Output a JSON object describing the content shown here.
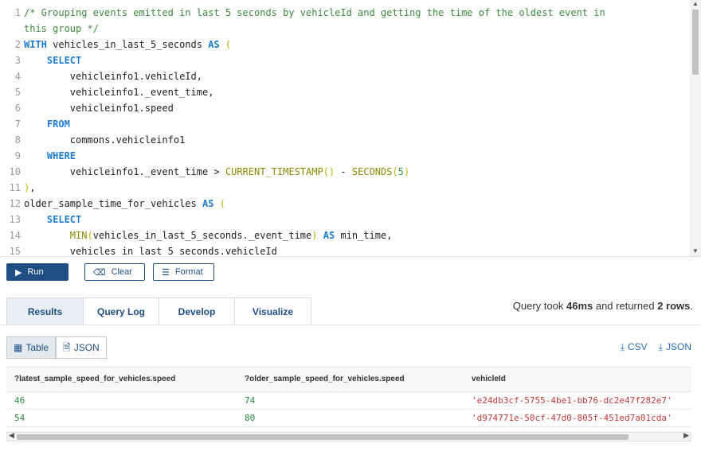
{
  "editor": {
    "lines": [
      {
        "n": "1",
        "parts": [
          {
            "c": "cm",
            "t": "/* Grouping events emitted in last 5 seconds by vehicleId and getting the time of the oldest event in"
          }
        ]
      },
      {
        "n": "",
        "parts": [
          {
            "c": "cm",
            "t": "this group */"
          }
        ]
      },
      {
        "n": "2",
        "parts": [
          {
            "c": "kw",
            "t": "WITH"
          },
          {
            "c": "txt",
            "t": " vehicles_in_last_5_seconds "
          },
          {
            "c": "kw",
            "t": "AS"
          },
          {
            "c": "pn",
            "t": " ("
          }
        ]
      },
      {
        "n": "3",
        "parts": [
          {
            "c": "txt",
            "t": "    "
          },
          {
            "c": "kw",
            "t": "SELECT"
          }
        ]
      },
      {
        "n": "4",
        "parts": [
          {
            "c": "txt",
            "t": "        vehicleinfo1.vehicleId,"
          }
        ]
      },
      {
        "n": "5",
        "parts": [
          {
            "c": "txt",
            "t": "        vehicleinfo1._event_time,"
          }
        ]
      },
      {
        "n": "6",
        "parts": [
          {
            "c": "txt",
            "t": "        vehicleinfo1.speed"
          }
        ]
      },
      {
        "n": "7",
        "parts": [
          {
            "c": "txt",
            "t": "    "
          },
          {
            "c": "kw",
            "t": "FROM"
          }
        ]
      },
      {
        "n": "8",
        "parts": [
          {
            "c": "txt",
            "t": "        commons.vehicleinfo1"
          }
        ]
      },
      {
        "n": "9",
        "parts": [
          {
            "c": "txt",
            "t": "    "
          },
          {
            "c": "kw",
            "t": "WHERE"
          }
        ]
      },
      {
        "n": "10",
        "parts": [
          {
            "c": "txt",
            "t": "        vehicleinfo1._event_time > "
          },
          {
            "c": "fn",
            "t": "CURRENT_TIMESTAMP"
          },
          {
            "c": "pn",
            "t": "()"
          },
          {
            "c": "txt",
            "t": " - "
          },
          {
            "c": "fn",
            "t": "SECONDS"
          },
          {
            "c": "pn",
            "t": "("
          },
          {
            "c": "nm",
            "t": "5"
          },
          {
            "c": "pn",
            "t": ")"
          }
        ]
      },
      {
        "n": "11",
        "parts": [
          {
            "c": "pn",
            "t": ")"
          },
          {
            "c": "txt",
            "t": ","
          }
        ]
      },
      {
        "n": "12",
        "parts": [
          {
            "c": "txt",
            "t": "older_sample_time_for_vehicles "
          },
          {
            "c": "kw",
            "t": "AS"
          },
          {
            "c": "pn",
            "t": " ("
          }
        ]
      },
      {
        "n": "13",
        "parts": [
          {
            "c": "txt",
            "t": "    "
          },
          {
            "c": "kw",
            "t": "SELECT"
          }
        ]
      },
      {
        "n": "14",
        "parts": [
          {
            "c": "txt",
            "t": "        "
          },
          {
            "c": "fn",
            "t": "MIN"
          },
          {
            "c": "pn",
            "t": "("
          },
          {
            "c": "txt",
            "t": "vehicles_in_last_5_seconds._event_time"
          },
          {
            "c": "pn",
            "t": ")"
          },
          {
            "c": "txt",
            "t": " "
          },
          {
            "c": "kw",
            "t": "AS"
          },
          {
            "c": "txt",
            "t": " min_time,"
          }
        ]
      },
      {
        "n": "15",
        "parts": [
          {
            "c": "txt",
            "t": "        vehicles_in_last_5_seconds.vehicleId"
          }
        ]
      }
    ]
  },
  "toolbar": {
    "run_label": "Run",
    "clear_label": "Clear",
    "format_label": "Format",
    "run_icon": "play-icon",
    "clear_icon": "eraser-icon",
    "format_icon": "format-icon"
  },
  "tabs": [
    {
      "label": "Results",
      "active": true
    },
    {
      "label": "Query Log",
      "active": false
    },
    {
      "label": "Develop",
      "active": false
    },
    {
      "label": "Visualize",
      "active": false
    }
  ],
  "status": {
    "prefix": "Query took ",
    "duration": "46ms",
    "middle": " and returned ",
    "rows": "2 rows",
    "suffix": "."
  },
  "view_toggle": {
    "table_label": "Table",
    "json_label": "JSON"
  },
  "exports": {
    "csv_label": "CSV",
    "json_label": "JSON"
  },
  "results": {
    "columns": [
      "?latest_sample_speed_for_vehicles.speed",
      "?older_sample_speed_for_vehicles.speed",
      "vehicleId"
    ],
    "rows": [
      [
        "46",
        "74",
        "'e24db3cf-5755-4be1-bb76-dc2e47f282e7'"
      ],
      [
        "54",
        "80",
        "'d974771e-50cf-47d0-805f-451ed7a01cda'"
      ]
    ]
  },
  "colors": {
    "accent": "#1f4e84",
    "keyword": "#1f7cd2",
    "comment": "#3d8a3d",
    "number": "#2b8a3e",
    "string": "#c33a3a"
  }
}
